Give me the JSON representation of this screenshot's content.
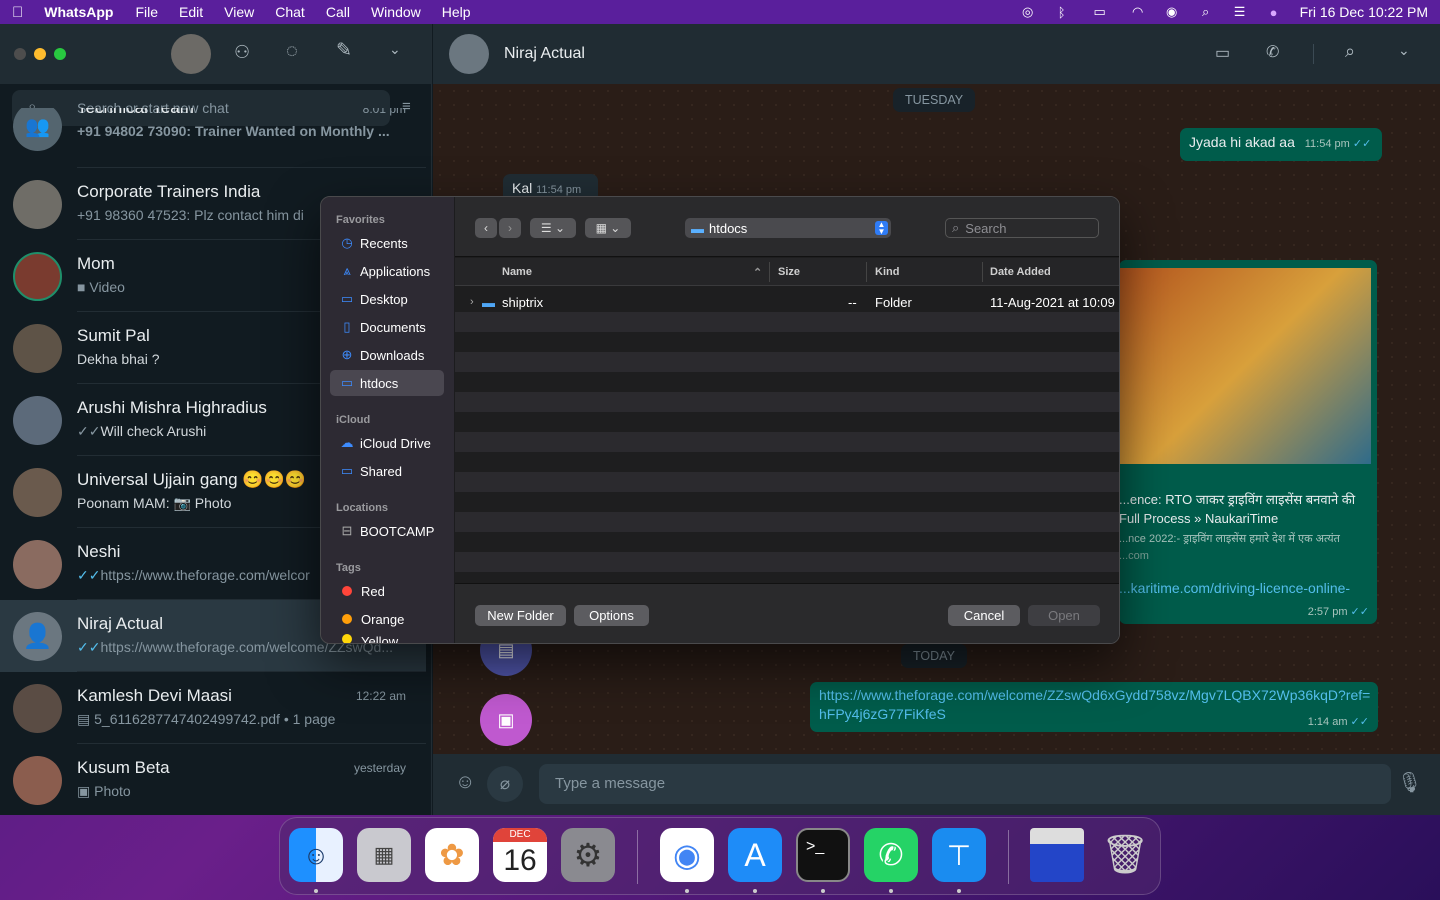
{
  "menubar": {
    "app": "WhatsApp",
    "items": [
      "File",
      "Edit",
      "View",
      "Chat",
      "Call",
      "Window",
      "Help"
    ],
    "clock": "Fri 16 Dec  10:22 PM"
  },
  "left": {
    "search_placeholder": "Search or start new chat",
    "chats": [
      {
        "name": "Technical Team",
        "preview": "+91 94802 73090: Trainer Wanted on Monthly ...",
        "time": "8:01 pm"
      },
      {
        "name": "Corporate Trainers India",
        "preview": "+91 98360 47523: Plz contact him di",
        "time": ""
      },
      {
        "name": "Mom",
        "preview": "Video",
        "time": ""
      },
      {
        "name": "Sumit Pal",
        "preview": "Dekha bhai ?",
        "time": ""
      },
      {
        "name": "Arushi Mishra Highradius",
        "preview": "Will check Arushi",
        "time": ""
      },
      {
        "name": "Universal Ujjain gang 😊😊😊",
        "preview": "Poonam MAM: 📷 Photo",
        "time": ""
      },
      {
        "name": "Neshi",
        "preview": "https://www.theforage.com/welcor",
        "time": ""
      },
      {
        "name": "Niraj Actual",
        "preview": "https://www.theforage.com/welcome/ZZswQd...",
        "time": ""
      },
      {
        "name": "Kamlesh Devi Maasi",
        "preview": "5_6116287747402499742.pdf • 1 page",
        "time": "12:22 am"
      },
      {
        "name": "Kusum Beta",
        "preview": "Photo",
        "time": "yesterday"
      }
    ]
  },
  "right": {
    "contact": "Niraj Actual",
    "day1": "TUESDAY",
    "msg_out1": "Jyada hi akad aa",
    "msg_out1_time": "11:54 pm",
    "msg_in1": "Kal",
    "msg_in1_time": "11:54 pm",
    "link_title": "...ence: RTO जाकर ड्राइविंग लाइसेंस बनवाने की Full Process » NaukariTime",
    "link_desc": "...nce 2022:- ड्राइविंग लाइसेंस हमारे देश में एक अत्यंत",
    "link_site": "...com",
    "link_url": "...karitime.com/driving-licence-online-",
    "link_time": "2:57 pm",
    "day2": "TODAY",
    "msg_out2": "https://www.theforage.com/welcome/ZZswQd6xGydd758vz/Mgv7LQBX72Wp36kqD?ref=hFPy4j6zG77FiKfeS",
    "msg_out2_time": "1:14 am",
    "composer_placeholder": "Type a message"
  },
  "dialog": {
    "sections": {
      "favorites": "Favorites",
      "icloud": "iCloud",
      "locations": "Locations",
      "tags": "Tags"
    },
    "favorites": [
      "Recents",
      "Applications",
      "Desktop",
      "Documents",
      "Downloads",
      "htdocs"
    ],
    "icloud": [
      "iCloud Drive",
      "Shared"
    ],
    "locations": [
      "BOOTCAMP"
    ],
    "tags": [
      {
        "label": "Red",
        "color": "#ff453a"
      },
      {
        "label": "Orange",
        "color": "#ff9f0a"
      },
      {
        "label": "Yellow",
        "color": "#ffd60a"
      }
    ],
    "path": "htdocs",
    "search_placeholder": "Search",
    "columns": {
      "name": "Name",
      "size": "Size",
      "kind": "Kind",
      "date": "Date Added"
    },
    "file": {
      "name": "shiptrix",
      "size": "--",
      "kind": "Folder",
      "date": "11-Aug-2021 at 10:09"
    },
    "buttons": {
      "new_folder": "New Folder",
      "options": "Options",
      "cancel": "Cancel",
      "open": "Open"
    }
  },
  "dock": {
    "calendar_month": "DEC",
    "calendar_day": "16"
  }
}
